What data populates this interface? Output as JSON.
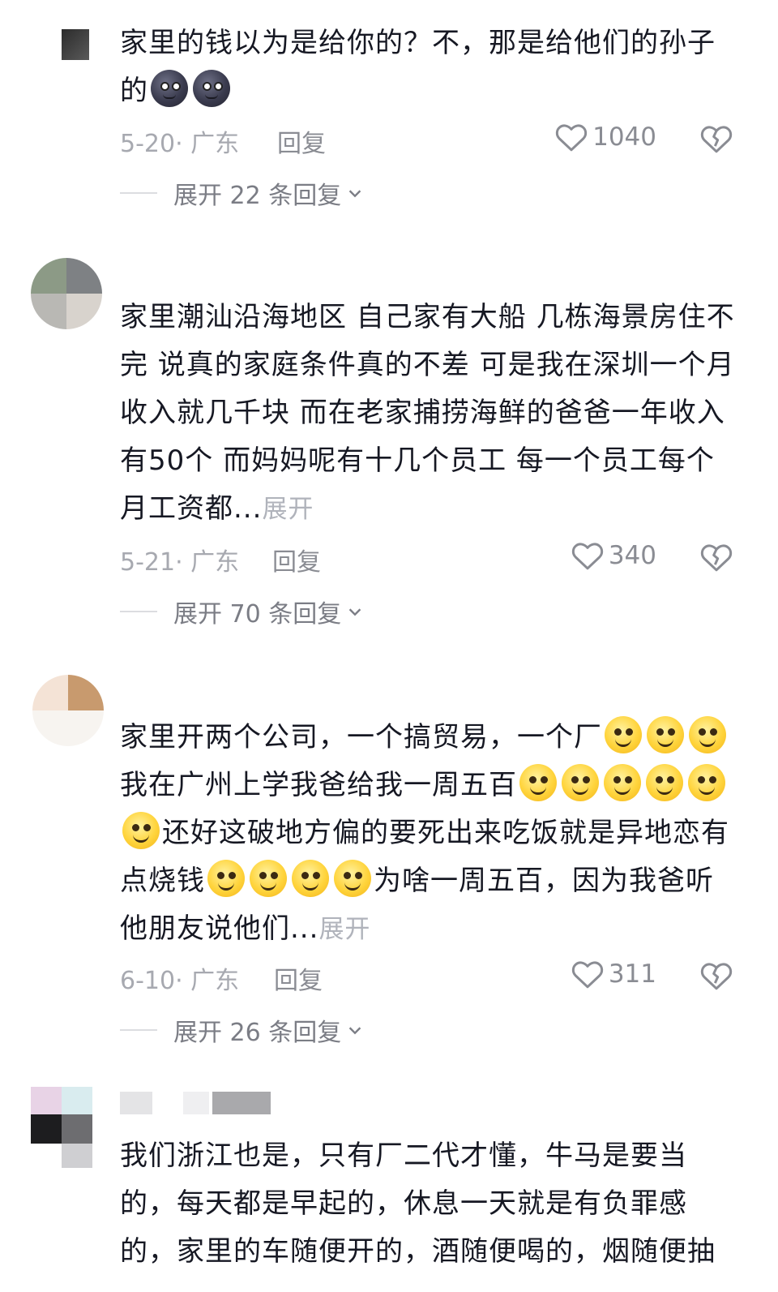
{
  "comments": [
    {
      "text": "家里的钱以为是给你的？不，那是给他们的孙子的",
      "emojis": [
        "moon-face",
        "moon-face"
      ],
      "date": "5-20",
      "region": "广东",
      "reply_label": "回复",
      "likes": "1040",
      "expand_label": "展开 22 条回复"
    },
    {
      "text": "家里潮汕沿海地区  自己家有大船  几栋海景房住不完  说真的家庭条件真的不差  可是我在深圳一个月收入就几千块  而在老家捕捞海鲜的爸爸一年收入有50个  而妈妈呢有十几个员工  每一个员工每个月工资都...",
      "more_label": "展开",
      "date": "5-21",
      "region": "广东",
      "reply_label": "回复",
      "likes": "340",
      "expand_label": "展开 70 条回复"
    },
    {
      "text_parts": [
        "家里开两个公司，一个搞贸易，一个厂",
        "我在广州上学我爸给我一周五百",
        "还好这破地方偏的要死出来吃饭就是异地恋有点烧钱",
        "为啥一周五百，因为我爸听他朋友说他们..."
      ],
      "more_label": "展开",
      "date": "6-10",
      "region": "广东",
      "reply_label": "回复",
      "likes": "311",
      "expand_label": "展开 26 条回复"
    },
    {
      "text": "我们浙江也是，只有厂二代才懂，牛马是要当的，每天都是早起的，休息一天就是有负罪感的，家里的车随便开的，酒随便喝的，烟随便抽"
    }
  ],
  "icons": {
    "like": "heart-outline-icon",
    "dislike": "broken-heart-icon",
    "expand": "chevron-down-icon",
    "emoji_moon": "new-moon-face-emoji",
    "emoji_smile": "smiling-face-emoji"
  },
  "colors": {
    "text": "#161823",
    "meta": "#a7a9b0",
    "secondary": "#8a8c93"
  }
}
